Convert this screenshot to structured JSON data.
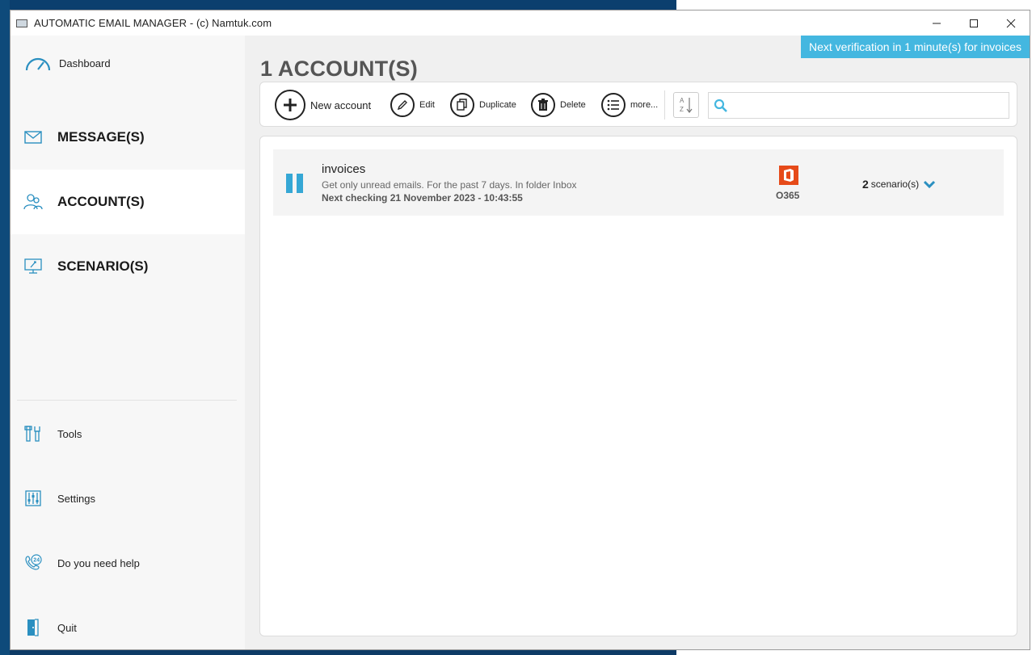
{
  "window": {
    "title": "AUTOMATIC EMAIL MANAGER - (c) Namtuk.com",
    "controls": {
      "minimize": "—",
      "maximize": "☐",
      "close": "✕"
    }
  },
  "sidebar": {
    "dashboard": "Dashboard",
    "nav": [
      {
        "label": "MESSAGE(S)",
        "icon": "envelope-icon"
      },
      {
        "label": "ACCOUNT(S)",
        "icon": "users-icon",
        "active": true
      },
      {
        "label": "SCENARIO(S)",
        "icon": "monitor-icon"
      }
    ],
    "bottom": [
      {
        "label": "Tools",
        "icon": "tools-icon"
      },
      {
        "label": "Settings",
        "icon": "settings-sliders-icon"
      },
      {
        "label": "Do you need help",
        "icon": "support-24-icon"
      },
      {
        "label": "Quit",
        "icon": "exit-door-icon"
      }
    ]
  },
  "main": {
    "title": "1 ACCOUNT(S)",
    "toast": "Next verification in 1 minute(s) for invoices",
    "toolbar": {
      "new_account": "New account",
      "edit": "Edit",
      "duplicate": "Duplicate",
      "delete": "Delete",
      "more": "more...",
      "sort_top": "A",
      "sort_bottom": "Z"
    },
    "search": {
      "value": "",
      "placeholder": ""
    },
    "accounts": [
      {
        "name": "invoices",
        "description": "Get only unread emails. For the past 7 days. In folder Inbox",
        "next_check": "Next checking 21 November 2023 - 10:43:55",
        "provider": "O365",
        "scenario_count": "2",
        "scenario_label": "scenario(s)"
      }
    ]
  },
  "colors": {
    "accent": "#44b7e0",
    "pause": "#35a7d5",
    "office": "#e64a19"
  }
}
